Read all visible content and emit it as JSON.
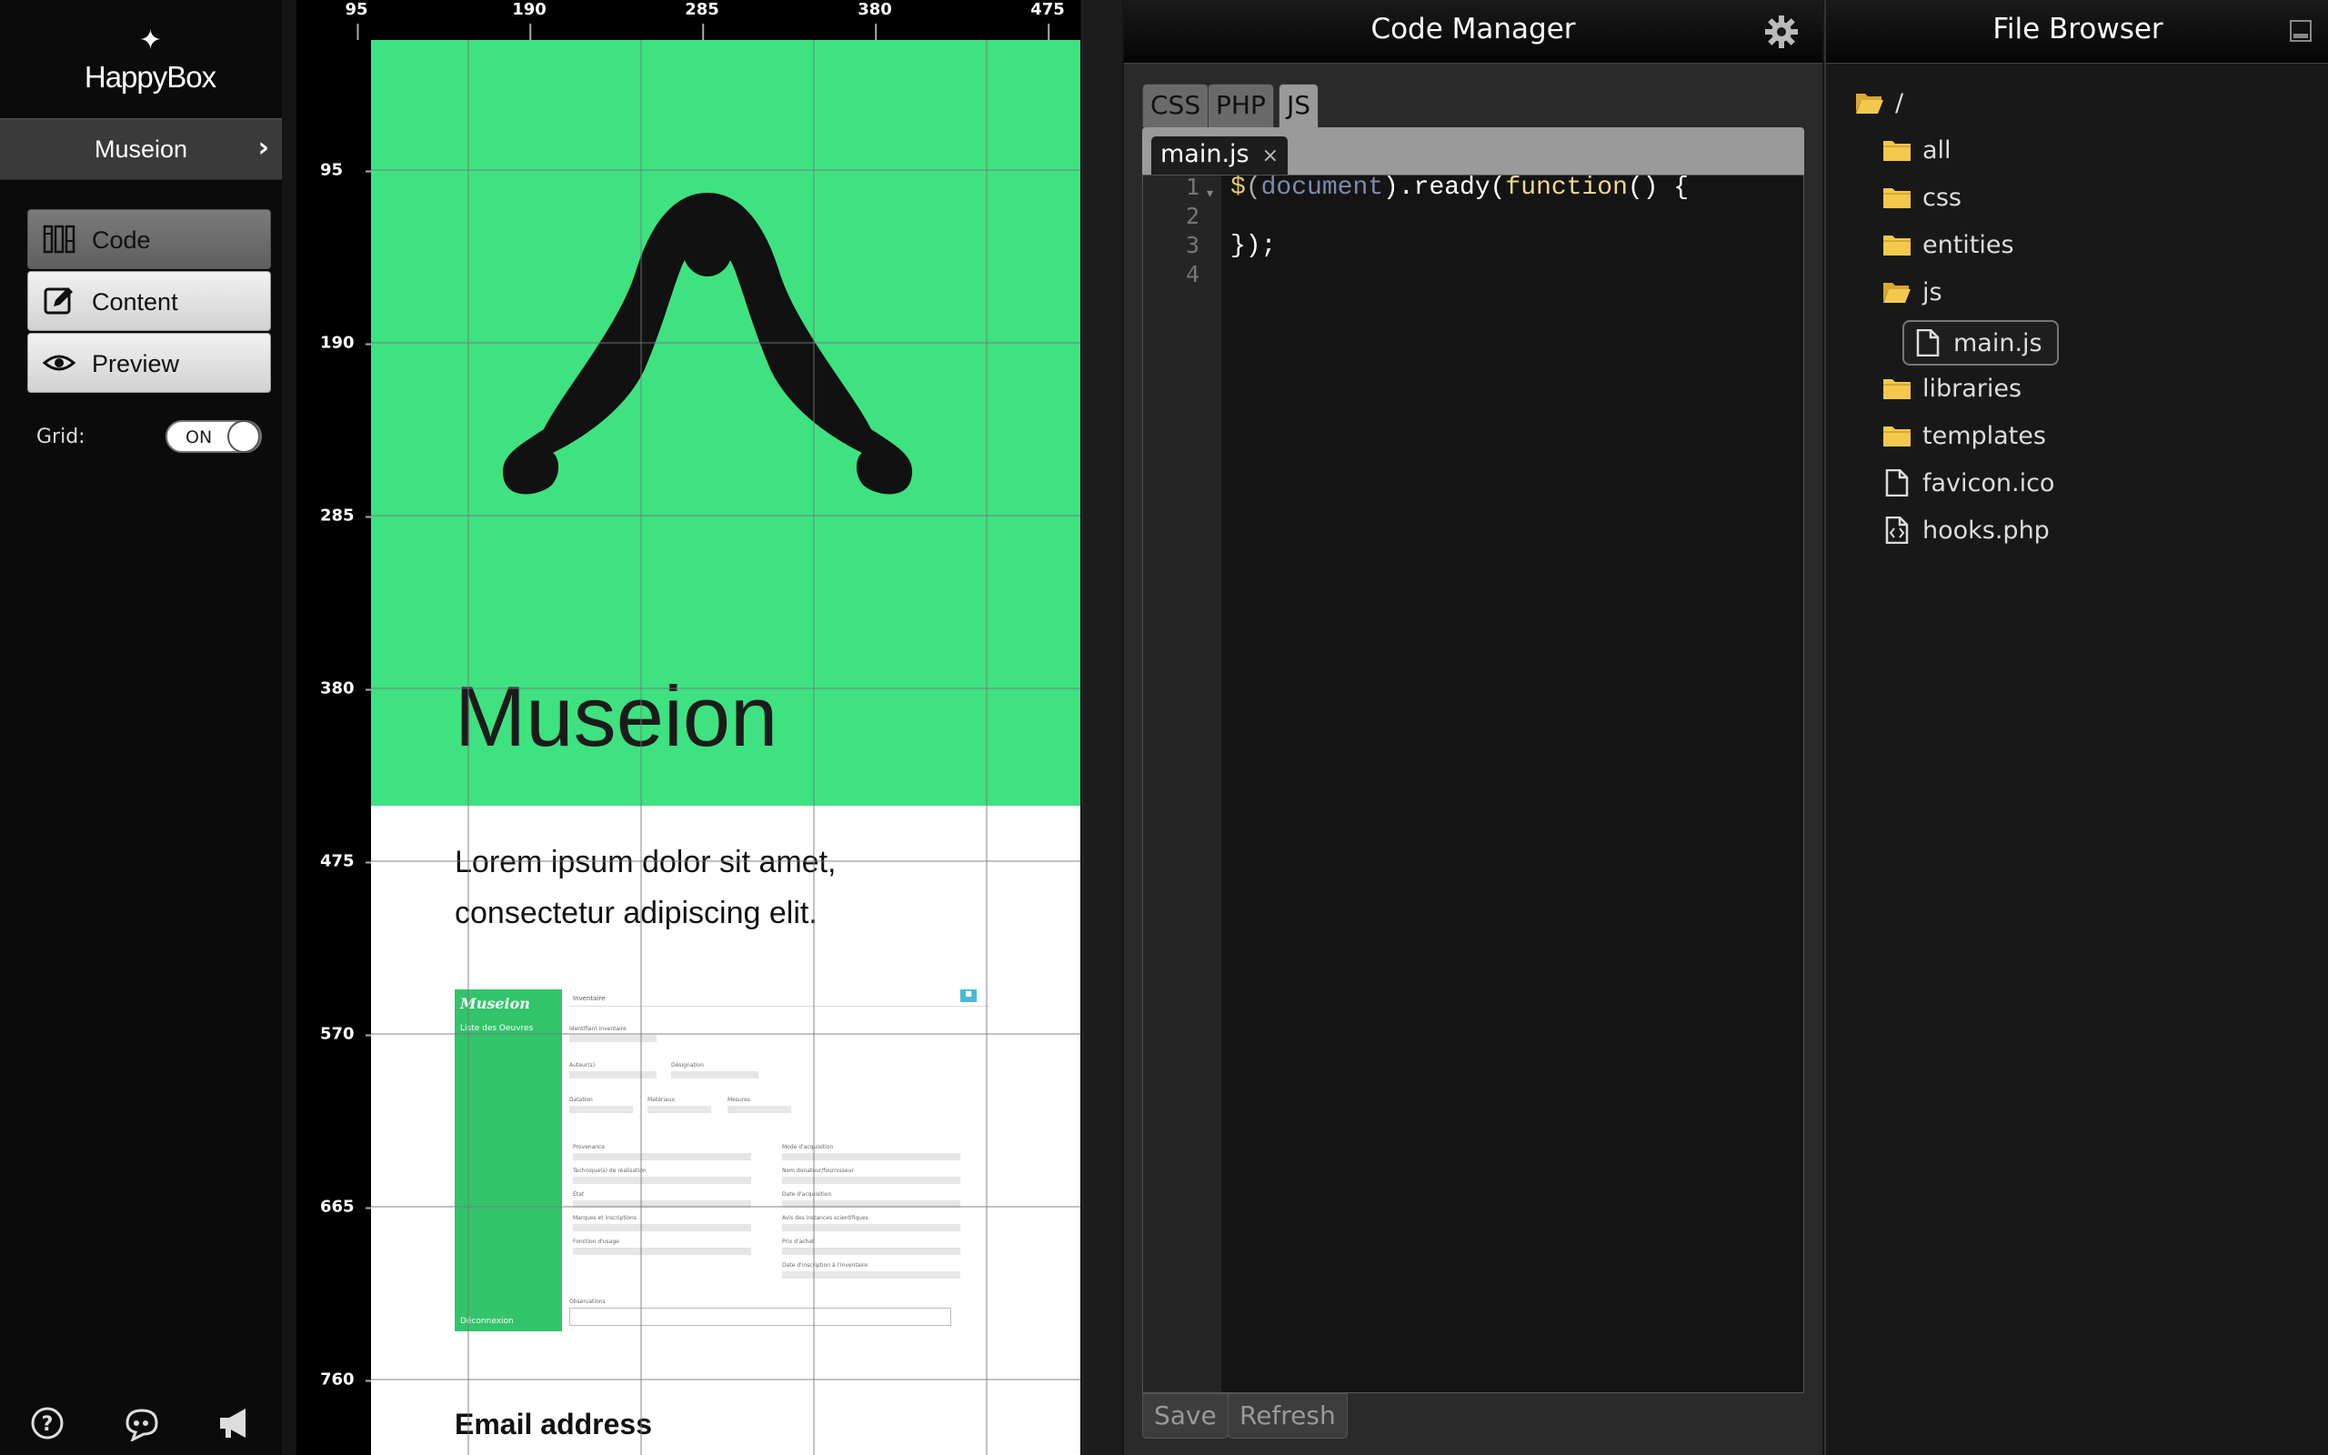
{
  "sidebar": {
    "brand": "HappyBox",
    "project": "Museion",
    "modes": [
      {
        "label": "Code",
        "icon": "code-ruler-icon",
        "active": true
      },
      {
        "label": "Content",
        "icon": "edit-icon",
        "active": false
      },
      {
        "label": "Preview",
        "icon": "eye-icon",
        "active": false
      }
    ],
    "grid_label": "Grid:",
    "grid_toggle": "ON",
    "footer_icons": [
      "help-icon",
      "chat-icon",
      "megaphone-icon"
    ]
  },
  "canvas": {
    "ruler_top": [
      "95",
      "190",
      "285",
      "380",
      "475"
    ],
    "ruler_left": [
      "95",
      "190",
      "285",
      "380",
      "475",
      "570",
      "665",
      "760"
    ],
    "hero_title": "Museion",
    "hero_color": "#3ee281",
    "lede": "Lorem ipsum dolor sit amet, consectetur adipiscing elit.",
    "mini": {
      "brand": "Museion",
      "nav_top": "Liste des Oeuvres",
      "nav_bottom": "Déconnexion",
      "tab": "Inventaire",
      "button": "■",
      "fields": [
        "Identifiant inventaire",
        "Auteur(s)",
        "Désignation",
        "Datation",
        "Matériaux",
        "Mesures",
        "Provenance",
        "Mode d'acquisition",
        "Technique(s) de réalisation",
        "Nom donateur/fournisseur",
        "État",
        "Date d'acquisition",
        "Marques et inscriptions",
        "Avis des instances scientifiques",
        "Fonction d'usage",
        "Prix d'achat",
        "Date d'inscription à l'inventaire",
        "Observations"
      ]
    },
    "email_label": "Email address"
  },
  "code_manager": {
    "title": "Code Manager",
    "lang_tabs": [
      "CSS",
      "PHP",
      "JS"
    ],
    "active_lang": "JS",
    "file_tab": "main.js",
    "file_tab_close": "×",
    "line_numbers": [
      "1",
      "2",
      "3",
      "4"
    ],
    "code": {
      "dollar": "$",
      "lparen": "(",
      "document": "document",
      "mid": ").ready(",
      "function": "function",
      "tail": "() {",
      "line3": "});"
    },
    "save": "Save",
    "refresh": "Refresh"
  },
  "file_browser": {
    "title": "File Browser",
    "root": "/",
    "items": [
      {
        "label": "all",
        "type": "folder"
      },
      {
        "label": "css",
        "type": "folder"
      },
      {
        "label": "entities",
        "type": "folder"
      },
      {
        "label": "js",
        "type": "folder-open"
      },
      {
        "label": "main.js",
        "type": "file",
        "selected": true
      },
      {
        "label": "libraries",
        "type": "folder"
      },
      {
        "label": "templates",
        "type": "folder"
      },
      {
        "label": "favicon.ico",
        "type": "file"
      },
      {
        "label": "hooks.php",
        "type": "code-file"
      }
    ]
  }
}
